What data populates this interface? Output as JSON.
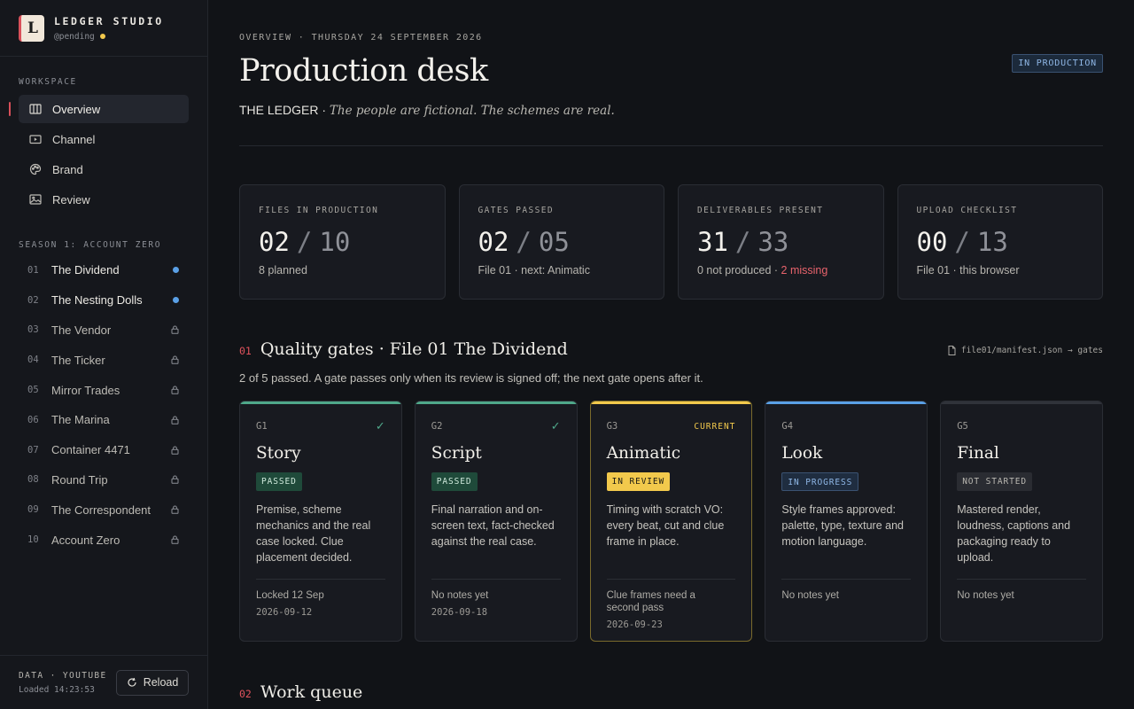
{
  "brand": {
    "name": "LEDGER STUDIO",
    "handle": "@pending",
    "logo_letter": "L"
  },
  "sidebar": {
    "workspace_label": "WORKSPACE",
    "nav": [
      {
        "label": "Overview",
        "icon": "columns-icon",
        "active": true
      },
      {
        "label": "Channel",
        "icon": "video-icon"
      },
      {
        "label": "Brand",
        "icon": "palette-icon"
      },
      {
        "label": "Review",
        "icon": "image-icon"
      }
    ],
    "season_label": "SEASON 1: ACCOUNT ZERO",
    "episodes": [
      {
        "num": "01",
        "title": "The Dividend",
        "status": "open"
      },
      {
        "num": "02",
        "title": "The Nesting Dolls",
        "status": "open"
      },
      {
        "num": "03",
        "title": "The Vendor",
        "status": "locked"
      },
      {
        "num": "04",
        "title": "The Ticker",
        "status": "locked"
      },
      {
        "num": "05",
        "title": "Mirror Trades",
        "status": "locked"
      },
      {
        "num": "06",
        "title": "The Marina",
        "status": "locked"
      },
      {
        "num": "07",
        "title": "Container 4471",
        "status": "locked"
      },
      {
        "num": "08",
        "title": "Round Trip",
        "status": "locked"
      },
      {
        "num": "09",
        "title": "The Correspondent",
        "status": "locked"
      },
      {
        "num": "10",
        "title": "Account Zero",
        "status": "locked"
      }
    ],
    "footer": {
      "data_source": "DATA · YOUTUBE",
      "loaded": "Loaded 14:23:53",
      "reload_label": "Reload"
    }
  },
  "header": {
    "breadcrumb": "OVERVIEW · THURSDAY 24 SEPTEMBER 2026",
    "title": "Production desk",
    "status_badge": "IN PRODUCTION",
    "show_name": "THE LEDGER",
    "tagline": "The people are fictional. The schemes are real."
  },
  "stats": [
    {
      "label": "FILES IN PRODUCTION",
      "value": "02",
      "total": "10",
      "note": "8 planned"
    },
    {
      "label": "GATES PASSED",
      "value": "02",
      "total": "05",
      "note": "File 01 · next: Animatic"
    },
    {
      "label": "DELIVERABLES PRESENT",
      "value": "31",
      "total": "33",
      "note": "0 not produced · ",
      "note_alert": "2 missing"
    },
    {
      "label": "UPLOAD CHECKLIST",
      "value": "00",
      "total": "13",
      "note": "File 01 · this browser"
    }
  ],
  "gates_section": {
    "num": "01",
    "title": "Quality gates · File 01 The Dividend",
    "source": "file01/manifest.json → gates",
    "description": "2 of 5 passed. A gate passes only when its review is signed off; the next gate opens after it.",
    "gates": [
      {
        "id": "G1",
        "title": "Story",
        "status": "PASSED",
        "check": "✓",
        "desc": "Premise, scheme mechanics and the real case locked. Clue placement decided.",
        "note": "Locked 12 Sep",
        "date": "2026-09-12"
      },
      {
        "id": "G2",
        "title": "Script",
        "status": "PASSED",
        "check": "✓",
        "desc": "Final narration and on-screen text, fact-checked against the real case.",
        "note": "No notes yet",
        "date": "2026-09-18"
      },
      {
        "id": "G3",
        "title": "Animatic",
        "status": "IN REVIEW",
        "current_label": "CURRENT",
        "desc": "Timing with scratch VO: every beat, cut and clue frame in place.",
        "note": "Clue frames need a second pass",
        "date": "2026-09-23"
      },
      {
        "id": "G4",
        "title": "Look",
        "status": "IN PROGRESS",
        "desc": "Style frames approved: palette, type, texture and motion language.",
        "note": "No notes yet"
      },
      {
        "id": "G5",
        "title": "Final",
        "status": "NOT STARTED",
        "desc": "Mastered render, loudness, captions and packaging ready to upload.",
        "note": "No notes yet"
      }
    ]
  },
  "queue_section": {
    "num": "02",
    "title": "Work queue"
  },
  "colors": {
    "accent": "#d9505a",
    "passed": "#4fa88a",
    "current": "#f2c94c",
    "progress": "#5aa0e6",
    "background": "#111317"
  }
}
